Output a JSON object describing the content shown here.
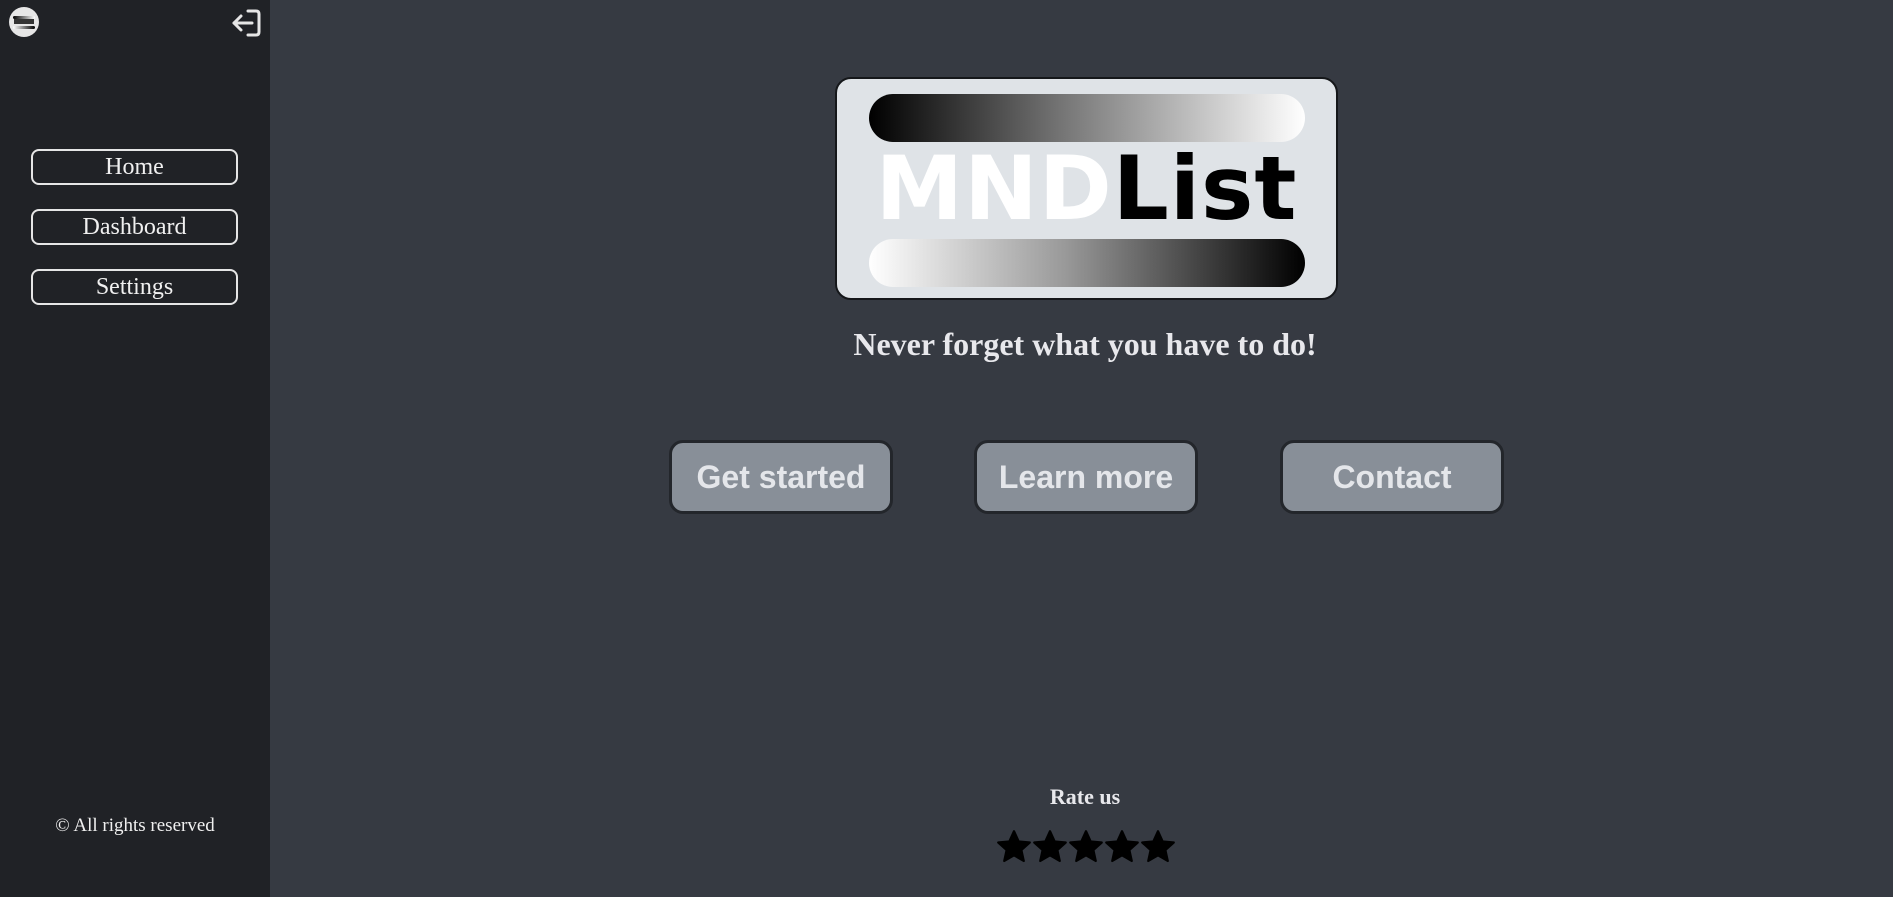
{
  "sidebar": {
    "avatar_icon": "app-logo-avatar-icon",
    "logout_icon": "logout-arrow-icon",
    "nav": [
      {
        "label": "Home"
      },
      {
        "label": "Dashboard"
      },
      {
        "label": "Settings"
      }
    ],
    "copyright": "© All rights reserved"
  },
  "main": {
    "logo": {
      "part1": "MND",
      "part2": "List"
    },
    "tagline": "Never forget what you have to do!",
    "buttons": {
      "get_started": "Get started",
      "learn_more": "Learn more",
      "contact": "Contact"
    },
    "rating": {
      "label": "Rate us",
      "max_stars": 5,
      "star_icon": "star-icon"
    }
  },
  "colors": {
    "page_bg": "#363a42",
    "sidebar_bg": "#202226",
    "button_bg": "#888f98",
    "logo_card_bg": "#dfe3e7",
    "text": "#e8e8ec"
  }
}
